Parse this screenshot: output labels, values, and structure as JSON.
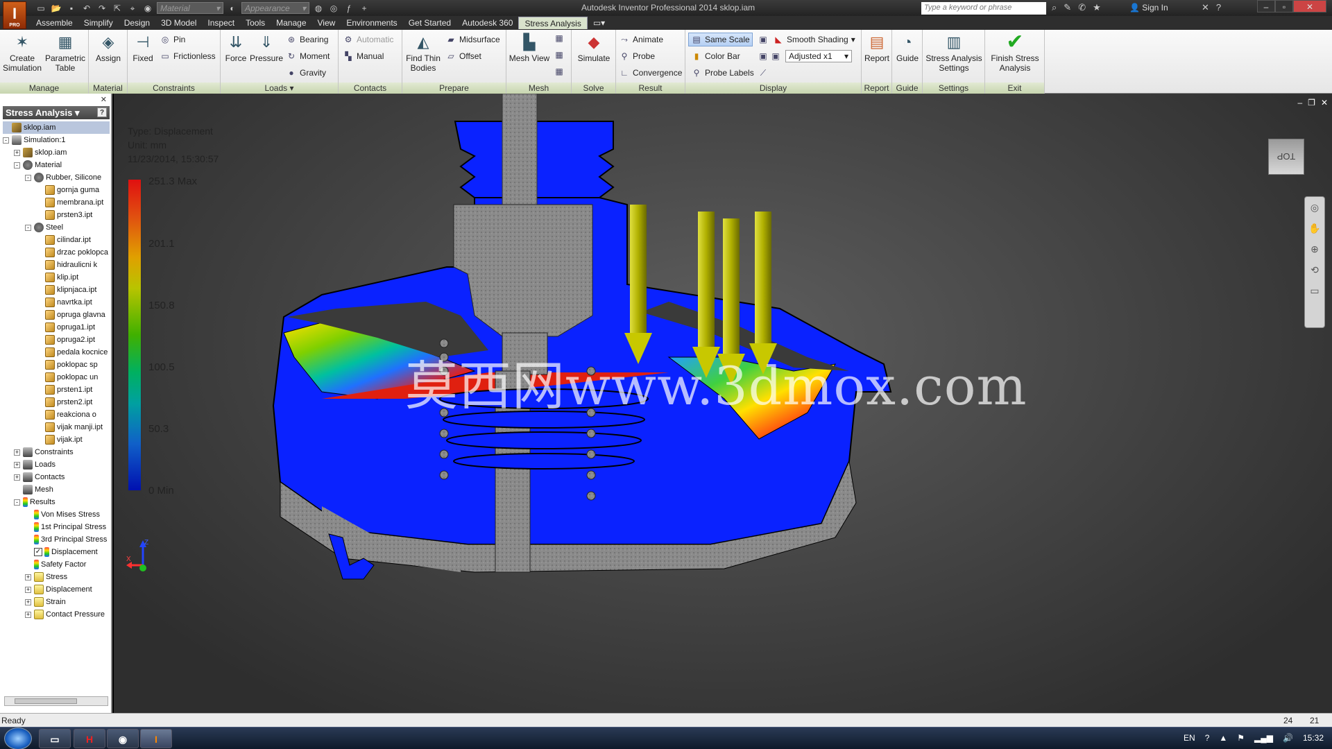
{
  "titlebar": {
    "app_letter": "I",
    "app_edition": "PRO",
    "material_combo": "Material",
    "appearance_combo": "Appearance",
    "title": "Autodesk Inventor Professional 2014    sklop.iam",
    "search_placeholder": "Type a keyword or phrase",
    "sign_in": "Sign In"
  },
  "tabs": [
    "Assemble",
    "Simplify",
    "Design",
    "3D Model",
    "Inspect",
    "Tools",
    "Manage",
    "View",
    "Environments",
    "Get Started",
    "Autodesk 360",
    "Stress Analysis"
  ],
  "active_tab": "Stress Analysis",
  "ribbon": {
    "panels": [
      "Manage",
      "Material",
      "Constraints",
      "Loads",
      "Contacts",
      "Prepare",
      "Mesh",
      "Solve",
      "Result",
      "Display",
      "Report",
      "Guide",
      "Settings",
      "Exit"
    ],
    "create_simulation": "Create Simulation",
    "parametric_table": "Parametric Table",
    "assign": "Assign",
    "fixed": "Fixed",
    "pin": "Pin",
    "frictionless": "Frictionless",
    "force": "Force",
    "pressure": "Pressure",
    "bearing": "Bearing",
    "moment": "Moment",
    "gravity": "Gravity",
    "automatic": "Automatic",
    "manual": "Manual",
    "find_thin_bodies": "Find Thin Bodies",
    "midsurface": "Midsurface",
    "offset": "Offset",
    "mesh_view": "Mesh View",
    "simulate": "Simulate",
    "animate": "Animate",
    "probe": "Probe",
    "convergence": "Convergence",
    "same_scale": "Same Scale",
    "color_bar": "Color Bar",
    "probe_labels": "Probe Labels",
    "smooth_shading": "Smooth Shading",
    "adjusted": "Adjusted x1",
    "report": "Report",
    "guide": "Guide",
    "settings": "Stress Analysis Settings",
    "finish": "Finish Stress Analysis"
  },
  "browser": {
    "title": "Stress Analysis",
    "tree": [
      {
        "label": "sklop.iam",
        "level": 0,
        "icon": "asm",
        "exp": "",
        "sel": true
      },
      {
        "label": "Simulation:1",
        "level": 0,
        "icon": "sim",
        "exp": "-"
      },
      {
        "label": "sklop.iam",
        "level": 1,
        "icon": "asm",
        "exp": "+"
      },
      {
        "label": "Material",
        "level": 1,
        "icon": "mat",
        "exp": "-"
      },
      {
        "label": "Rubber, Silicone",
        "level": 2,
        "icon": "mat",
        "exp": "-"
      },
      {
        "label": "gornja guma",
        "level": 3,
        "icon": "part",
        "exp": ""
      },
      {
        "label": "membrana.ipt",
        "level": 3,
        "icon": "part",
        "exp": ""
      },
      {
        "label": "prsten3.ipt",
        "level": 3,
        "icon": "part",
        "exp": ""
      },
      {
        "label": "Steel",
        "level": 2,
        "icon": "mat",
        "exp": "-"
      },
      {
        "label": "cilindar.ipt",
        "level": 3,
        "icon": "part",
        "exp": ""
      },
      {
        "label": "drzac poklopca",
        "level": 3,
        "icon": "part",
        "exp": ""
      },
      {
        "label": "hidraulicni k",
        "level": 3,
        "icon": "part",
        "exp": ""
      },
      {
        "label": "klip.ipt",
        "level": 3,
        "icon": "part",
        "exp": ""
      },
      {
        "label": "klipnjaca.ipt",
        "level": 3,
        "icon": "part",
        "exp": ""
      },
      {
        "label": "navrtka.ipt",
        "level": 3,
        "icon": "part",
        "exp": ""
      },
      {
        "label": "opruga glavna",
        "level": 3,
        "icon": "part",
        "exp": ""
      },
      {
        "label": "opruga1.ipt",
        "level": 3,
        "icon": "part",
        "exp": ""
      },
      {
        "label": "opruga2.ipt",
        "level": 3,
        "icon": "part",
        "exp": ""
      },
      {
        "label": "pedala kocnice",
        "level": 3,
        "icon": "part",
        "exp": ""
      },
      {
        "label": "poklopac sp",
        "level": 3,
        "icon": "part",
        "exp": ""
      },
      {
        "label": "poklopac un",
        "level": 3,
        "icon": "part",
        "exp": ""
      },
      {
        "label": "prsten1.ipt",
        "level": 3,
        "icon": "part",
        "exp": ""
      },
      {
        "label": "prsten2.ipt",
        "level": 3,
        "icon": "part",
        "exp": ""
      },
      {
        "label": "reakciona o",
        "level": 3,
        "icon": "part",
        "exp": ""
      },
      {
        "label": "vijak manji.ipt",
        "level": 3,
        "icon": "part",
        "exp": ""
      },
      {
        "label": "vijak.ipt",
        "level": 3,
        "icon": "part",
        "exp": ""
      },
      {
        "label": "Constraints",
        "level": 1,
        "icon": "con",
        "exp": "+"
      },
      {
        "label": "Loads",
        "level": 1,
        "icon": "con",
        "exp": "+"
      },
      {
        "label": "Contacts",
        "level": 1,
        "icon": "con",
        "exp": "+"
      },
      {
        "label": "Mesh",
        "level": 1,
        "icon": "con",
        "exp": ""
      },
      {
        "label": "Results",
        "level": 1,
        "icon": "res",
        "exp": "-"
      },
      {
        "label": "Von Mises Stress",
        "level": 2,
        "icon": "res",
        "exp": ""
      },
      {
        "label": "1st Principal Stress",
        "level": 2,
        "icon": "res",
        "exp": ""
      },
      {
        "label": "3rd Principal Stress",
        "level": 2,
        "icon": "res",
        "exp": ""
      },
      {
        "label": "Displacement",
        "level": 2,
        "icon": "res",
        "exp": "",
        "checked": true
      },
      {
        "label": "Safety Factor",
        "level": 2,
        "icon": "res",
        "exp": ""
      },
      {
        "label": "Stress",
        "level": 2,
        "icon": "fold",
        "exp": "+"
      },
      {
        "label": "Displacement",
        "level": 2,
        "icon": "fold",
        "exp": "+"
      },
      {
        "label": "Strain",
        "level": 2,
        "icon": "fold",
        "exp": "+"
      },
      {
        "label": "Contact Pressure",
        "level": 2,
        "icon": "fold",
        "exp": "+"
      }
    ]
  },
  "legend": {
    "type": "Type: Displacement",
    "unit": "Unit: mm",
    "date": "11/23/2014, 15:30:57",
    "ticks": [
      "251.3 Max",
      "201.1",
      "150.8",
      "100.5",
      "50.3",
      "0 Min"
    ]
  },
  "viewcube_label": "TOP",
  "watermark": "莫西网www.3dmox.com",
  "status": {
    "text": "Ready",
    "num1": "24",
    "num2": "21"
  },
  "taskbar": {
    "lang": "EN",
    "time": "15:32"
  }
}
